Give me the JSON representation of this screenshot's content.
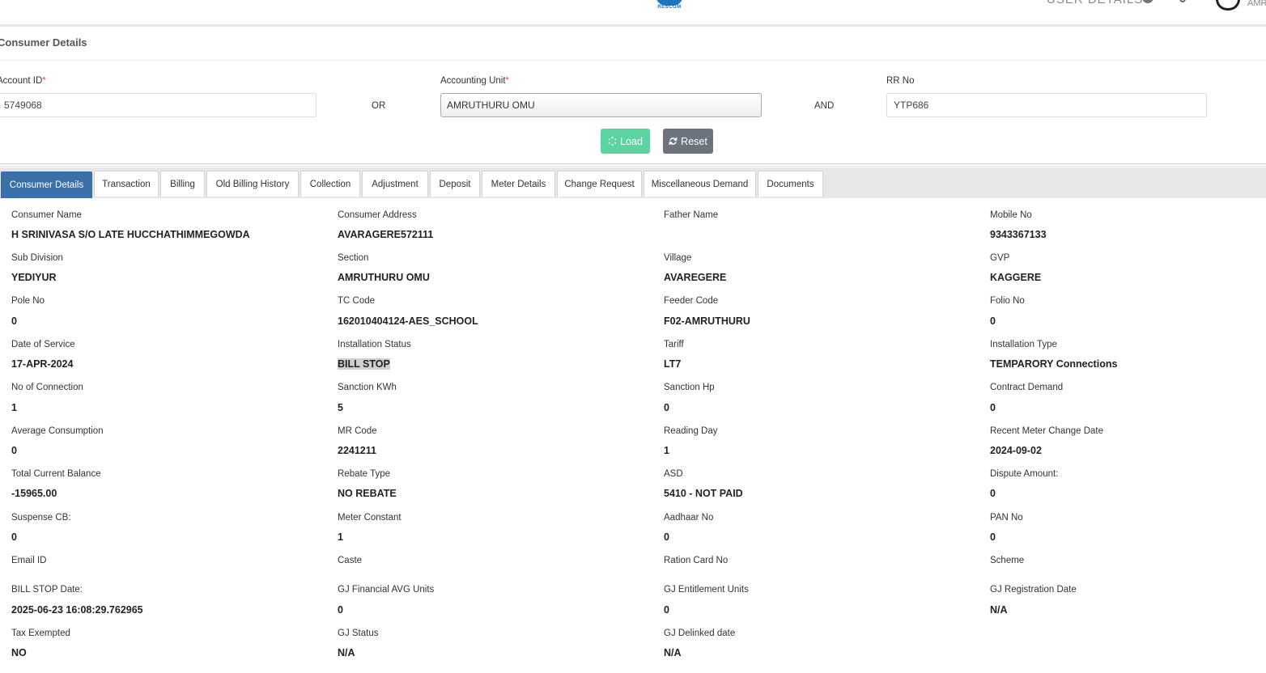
{
  "header": {
    "logo_text": "RESCOM",
    "user_details": "USER DETAILS",
    "user_short": "AMR"
  },
  "section_title": "Consumer Details",
  "form": {
    "account_id_label": "Account ID",
    "account_id_value": "5749068",
    "or": "OR",
    "accounting_unit_label": "Accounting Unit",
    "accounting_unit_value": "AMRUTHURU OMU",
    "and": "AND",
    "rr_no_label": "RR No",
    "rr_no_value": "YTP686",
    "required_mark": "*",
    "load_label": "Load",
    "reset_label": "Reset"
  },
  "tabs": [
    "Consumer Details",
    "Transaction",
    "Billing",
    "Old Billing History",
    "Collection",
    "Adjustment",
    "Deposit",
    "Meter Details",
    "Change Request",
    "Miscellaneous Demand",
    "Documents"
  ],
  "details": [
    [
      {
        "label": "Consumer Name",
        "value": "H SRINIVASA S/O LATE HUCCHATHIMMEGOWDA"
      },
      {
        "label": "Consumer Address",
        "value": "AVARAGERE572111"
      },
      {
        "label": "Father Name",
        "value": ""
      },
      {
        "label": "Mobile No",
        "value": "9343367133"
      }
    ],
    [
      {
        "label": "Sub Division",
        "value": "YEDIYUR"
      },
      {
        "label": "Section",
        "value": "AMRUTHURU OMU"
      },
      {
        "label": "Village",
        "value": "AVAREGERE"
      },
      {
        "label": "GVP",
        "value": "KAGGERE"
      }
    ],
    [
      {
        "label": "Pole No",
        "value": "0"
      },
      {
        "label": "TC Code",
        "value": "162010404124-AES_SCHOOL"
      },
      {
        "label": "Feeder Code",
        "value": "F02-AMRUTHURU"
      },
      {
        "label": "Folio No",
        "value": "0"
      }
    ],
    [
      {
        "label": "Date of Service",
        "value": "17-APR-2024"
      },
      {
        "label": "Installation Status",
        "value": "BILL STOP"
      },
      {
        "label": "Tariff",
        "value": "LT7"
      },
      {
        "label": "Installation Type",
        "value": "TEMPARORY Connections"
      }
    ],
    [
      {
        "label": "No of Connection",
        "value": "1"
      },
      {
        "label": "Sanction KWh",
        "value": "5"
      },
      {
        "label": "Sanction Hp",
        "value": "0"
      },
      {
        "label": "Contract Demand",
        "value": "0"
      }
    ],
    [
      {
        "label": "Average Consumption",
        "value": "0"
      },
      {
        "label": "MR Code",
        "value": "2241211"
      },
      {
        "label": "Reading Day",
        "value": "1"
      },
      {
        "label": "Recent Meter Change Date",
        "value": "2024-09-02"
      }
    ],
    [
      {
        "label": "Total Current Balance",
        "value": "-15965.00"
      },
      {
        "label": "Rebate Type",
        "value": "NO REBATE"
      },
      {
        "label": "ASD",
        "value": "5410 - NOT PAID"
      },
      {
        "label": "Dispute Amount:",
        "value": "0"
      }
    ],
    [
      {
        "label": "Suspense CB:",
        "value": "0"
      },
      {
        "label": "Meter Constant",
        "value": "1"
      },
      {
        "label": "Aadhaar No",
        "value": "0"
      },
      {
        "label": "PAN No",
        "value": "0"
      }
    ],
    [
      {
        "label": "Email ID",
        "value": ""
      },
      {
        "label": "Caste",
        "value": ""
      },
      {
        "label": "Ration Card No",
        "value": ""
      },
      {
        "label": "Scheme",
        "value": ""
      }
    ],
    [
      {
        "label": "BILL STOP Date:",
        "value": "2025-06-23 16:08:29.762965"
      },
      {
        "label": "GJ Financial AVG Units",
        "value": "0"
      },
      {
        "label": "GJ Entitlement Units",
        "value": "0"
      },
      {
        "label": "GJ Registration Date",
        "value": "N/A"
      }
    ],
    [
      {
        "label": "Tax Exempted",
        "value": "NO"
      },
      {
        "label": "GJ Status",
        "value": "N/A"
      },
      {
        "label": "GJ Delinked date",
        "value": "N/A"
      }
    ]
  ]
}
